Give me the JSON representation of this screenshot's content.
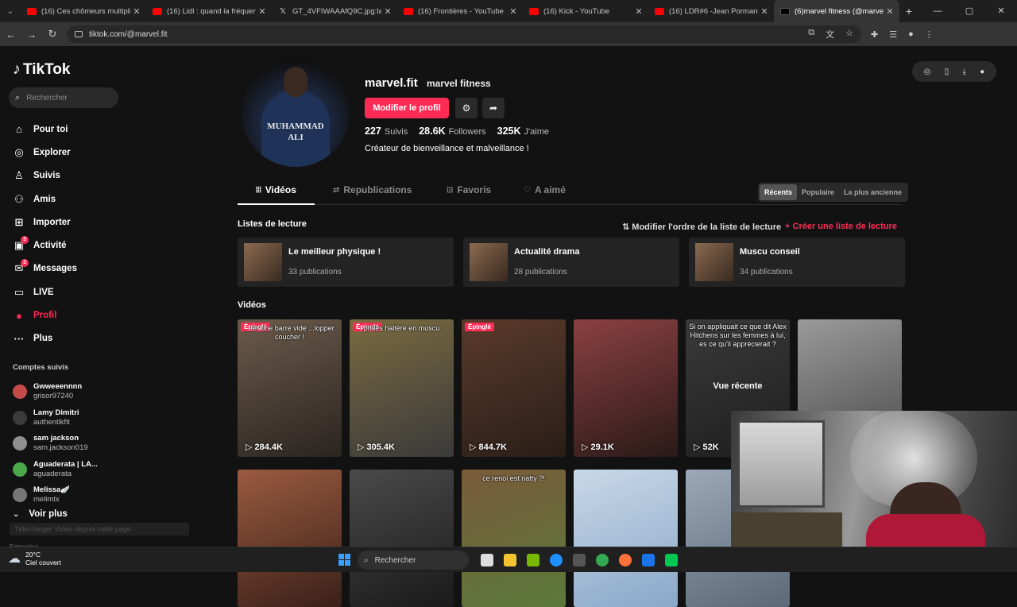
{
  "browser": {
    "tabs": [
      {
        "title": "(16) Ces chômeurs multiplient l",
        "icon": "youtube-icon"
      },
      {
        "title": "(16) Lidl : quand la fréquence d",
        "icon": "youtube-icon"
      },
      {
        "title": "GT_4VFIWAAAfQ9C.jpg:large (",
        "icon": "x-icon"
      },
      {
        "title": "(16) Frontières - YouTube",
        "icon": "youtube-icon"
      },
      {
        "title": "(16) Kick - YouTube",
        "icon": "youtube-icon"
      },
      {
        "title": "(16) LDR#6 -Jean Pormanove -",
        "icon": "youtube-icon"
      },
      {
        "title": "(6)marvel fitness (@marvel.fit) |",
        "icon": "tiktok-icon",
        "active": true
      }
    ],
    "url": "tiktok.com/@marvel.fit"
  },
  "sidebar": {
    "logo": "TikTok",
    "search_placeholder": "Rechercher",
    "nav": [
      {
        "label": "Pour toi",
        "icon": "home-icon"
      },
      {
        "label": "Explorer",
        "icon": "compass-icon"
      },
      {
        "label": "Suivis",
        "icon": "following-icon"
      },
      {
        "label": "Amis",
        "icon": "friends-icon"
      },
      {
        "label": "Importer",
        "icon": "upload-icon"
      },
      {
        "label": "Activité",
        "icon": "activity-icon",
        "badge": "3"
      },
      {
        "label": "Messages",
        "icon": "messages-icon",
        "badge": "3"
      },
      {
        "label": "LIVE",
        "icon": "live-icon"
      },
      {
        "label": "Profil",
        "icon": "profile-icon",
        "active": true
      },
      {
        "label": "Plus",
        "icon": "more-icon"
      }
    ],
    "followed_title": "Comptes suivis",
    "followed": [
      {
        "name": "Gwweeennnn",
        "user": "grisor97240",
        "color": "#c44a4a"
      },
      {
        "name": "Lamy Dimitri",
        "user": "authentikfit",
        "color": "#3b3b3b"
      },
      {
        "name": "sam jackson",
        "user": "sam.jackson019",
        "color": "#8f8f8f"
      },
      {
        "name": "Aguaderata | LA...",
        "user": "aguaderata",
        "color": "#4aa84a"
      },
      {
        "name": "Melissa🪽",
        "user": "melimtx",
        "color": "#777"
      }
    ],
    "see_more": "Voir plus",
    "download_bar": "Télécharger Video depuis cette page",
    "footer_partial": "Entreprise"
  },
  "profile": {
    "username": "marvel.fit",
    "nickname": "marvel fitness",
    "edit_label": "Modifier le profil",
    "avatar_text": "MUHAMMAD ALI",
    "stats": [
      {
        "value": "227",
        "label": "Suivis"
      },
      {
        "value": "28.6K",
        "label": "Followers"
      },
      {
        "value": "325K",
        "label": "J'aime"
      }
    ],
    "bio": "Créateur de bienveillance et malveillance !"
  },
  "tabs": [
    {
      "label": "Vidéos",
      "icon": "grid-icon",
      "active": true
    },
    {
      "label": "Republications",
      "icon": "repost-icon"
    },
    {
      "label": "Favoris",
      "icon": "bookmark-icon"
    },
    {
      "label": "A aimé",
      "icon": "heart-icon"
    }
  ],
  "sort": [
    "Récents",
    "Populaire",
    "La plus ancienne"
  ],
  "playlists": {
    "title": "Listes de lecture",
    "reorder_label": "Modifier l'ordre de la liste de lecture",
    "create_label": "Créer une liste de lecture",
    "items": [
      {
        "title": "Le meilleur physique !",
        "count": "33 publications"
      },
      {
        "title": "Actualité drama",
        "count": "28 publications"
      },
      {
        "title": "Muscu conseil",
        "count": "34 publications"
      }
    ]
  },
  "videos": {
    "title": "Vidéos",
    "pinned_label": "Épinglé",
    "recent_label": "Vue récente",
    "row1": [
      {
        "views": "284.4K",
        "pinned": true,
        "caption": "...ler une barre vide ...lopper coucher !",
        "colors": [
          "#6b5a4a",
          "#2a2420"
        ]
      },
      {
        "views": "305.4K",
        "pinned": true,
        "caption": "prises haltère en muscu",
        "colors": [
          "#7a6a40",
          "#3a3a3a"
        ]
      },
      {
        "views": "844.7K",
        "pinned": true,
        "caption": "",
        "colors": [
          "#5a3a2a",
          "#2a1e18"
        ]
      },
      {
        "views": "29.1K",
        "pinned": false,
        "caption": "",
        "colors": [
          "#8a4040",
          "#2a1a18"
        ]
      },
      {
        "views": "52K",
        "pinned": false,
        "caption": "Si on appliquait ce que dit Alex Hitchens sur les femmes à lui, es ce qu'il apprécierait ?",
        "colors": [
          "#3a3a3a",
          "#1e1e1e"
        ],
        "recent": true
      },
      {
        "views": "",
        "pinned": false,
        "caption": "",
        "colors": [
          "#9a9a9a",
          "#4a4a4a"
        ]
      }
    ],
    "row2": [
      {
        "caption": "",
        "colors": [
          "#9a5a40",
          "#3a2018"
        ]
      },
      {
        "caption": "",
        "colors": [
          "#4a4a4a",
          "#1a1a1a"
        ]
      },
      {
        "caption": "ce renoi est natty ?!",
        "colors": [
          "#7a5a3a",
          "#5a7a3a"
        ]
      },
      {
        "caption": "",
        "colors": [
          "#c8d8e8",
          "#8aa8c8"
        ]
      },
      {
        "caption": "",
        "colors": [
          "#9aa8b8",
          "#5a6878"
        ]
      }
    ]
  },
  "taskbar": {
    "temp": "20°C",
    "weather": "Ciel couvert",
    "search": "Rechercher"
  }
}
